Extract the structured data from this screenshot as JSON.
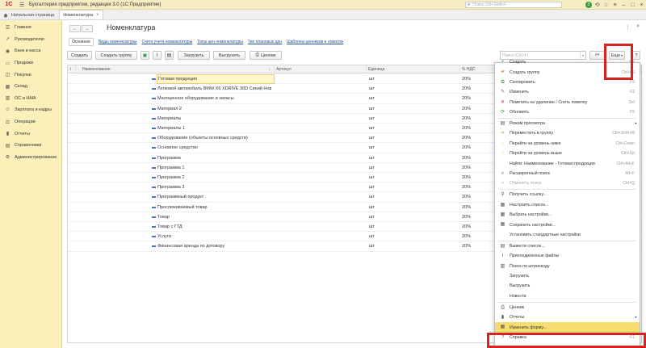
{
  "app": {
    "logo": "1С",
    "title": "Бухгалтерия предприятия, редакция 3.0  (1С:Предприятие)",
    "search_placeholder": "Поиск Ctrl+Shift+F",
    "bell_count": "3"
  },
  "tabs": {
    "home": "Начальная страница",
    "active": "Номенклатура"
  },
  "sidebar": {
    "items": [
      {
        "label": "Главное",
        "icon": "menu-icon"
      },
      {
        "label": "Руководителю",
        "icon": "chart-line-icon"
      },
      {
        "label": "Банк и касса",
        "icon": "bank-icon"
      },
      {
        "label": "Продажи",
        "icon": "cart-icon"
      },
      {
        "label": "Покупки",
        "icon": "basket-icon"
      },
      {
        "label": "Склад",
        "icon": "warehouse-icon"
      },
      {
        "label": "ОС и НМА",
        "icon": "assets-icon"
      },
      {
        "label": "Зарплата и кадры",
        "icon": "people-icon"
      },
      {
        "label": "Операции",
        "icon": "operations-icon"
      },
      {
        "label": "Отчеты",
        "icon": "report-icon"
      },
      {
        "label": "Справочники",
        "icon": "book-icon"
      },
      {
        "label": "Администрирование",
        "icon": "gear-icon"
      }
    ]
  },
  "page": {
    "title": "Номенклатура",
    "more_glyph": "⋮",
    "close_glyph": "×",
    "back_glyph": "←",
    "forward_glyph": "→"
  },
  "links": [
    {
      "label": "Основное",
      "active": true
    },
    {
      "label": "Виды номенклатуры"
    },
    {
      "label": "Счета учета номенклатуры"
    },
    {
      "label": "Типы цен номенклатуры"
    },
    {
      "label": "Тип плановых цен"
    },
    {
      "label": "Шаблоны ценников и этикеток"
    }
  ],
  "toolbar": {
    "create": "Создать",
    "create_group": "Создать группу",
    "load": "Загрузить",
    "unload": "Выгрузить",
    "price_tags": "Ценник",
    "search_placeholder": "Поиск (Ctrl+F)",
    "more": "Еще",
    "help": "?"
  },
  "table": {
    "columns": [
      "Наименование",
      "Артикул",
      "Единица",
      "% НДС"
    ],
    "rows": [
      {
        "name": "Готовая продукция",
        "unit": "шт",
        "vat": "20%"
      },
      {
        "name": "Легковой автомобиль  BMW X6  XDRIVE 30D Синий Нов",
        "unit": "шт",
        "vat": "20%"
      },
      {
        "name": "Малоценное оборудование и запасы",
        "unit": "шт",
        "vat": "20%"
      },
      {
        "name": "Материал 2",
        "unit": "шт",
        "vat": "20%"
      },
      {
        "name": "Материалы",
        "unit": "шт",
        "vat": "20%"
      },
      {
        "name": "Материалы 1",
        "unit": "шт",
        "vat": "20%"
      },
      {
        "name": "Оборудование (объекты основных средств)",
        "unit": "шт",
        "vat": "20%"
      },
      {
        "name": "Основное средство",
        "unit": "шт",
        "vat": "20%"
      },
      {
        "name": "Программа",
        "unit": "шт",
        "vat": "20%"
      },
      {
        "name": "Программа 1",
        "unit": "шт",
        "vat": "20%"
      },
      {
        "name": "Программа 2",
        "unit": "шт",
        "vat": "20%"
      },
      {
        "name": "Программа 3",
        "unit": "шт",
        "vat": "20%"
      },
      {
        "name": "Программный продукт",
        "unit": "шт",
        "vat": "20%"
      },
      {
        "name": "Прослеживаемый товар",
        "unit": "шт",
        "vat": "20%"
      },
      {
        "name": "Товар",
        "unit": "шт",
        "vat": "20%"
      },
      {
        "name": "Товар с ГТД",
        "unit": "шт",
        "vat": "20%"
      },
      {
        "name": "Услуги",
        "unit": "шт",
        "vat": "20%"
      },
      {
        "name": "Финансовая аренда по договору",
        "unit": "шт",
        "vat": "20%"
      }
    ]
  },
  "menu": {
    "items": [
      {
        "label": "Создать",
        "key": "Ins",
        "icon": "create-icon",
        "color": "#3a9b3e"
      },
      {
        "label": "Создать группу",
        "key": "Ctrl+F9",
        "icon": "folder-add-icon",
        "color": "#d6a53a"
      },
      {
        "label": "Скопировать",
        "key": "F9",
        "icon": "copy-icon",
        "color": "#3a9b3e"
      },
      {
        "label": "Изменить",
        "key": "F2",
        "icon": "edit-icon",
        "color": "#3a9b3e"
      },
      {
        "label": "Пометить на удаление / Снять пометку",
        "key": "Del",
        "icon": "delete-mark-icon",
        "color": "#d62222"
      },
      {
        "label": "Обновить",
        "key": "F5",
        "icon": "refresh-icon",
        "color": "#3a9b3e"
      },
      {
        "label": "Режим просмотра",
        "icon": "view-mode-icon",
        "submenu": true,
        "color": "#555"
      },
      {
        "label": "Переместить в группу",
        "key": "Ctrl+Shift+M",
        "icon": "move-group-icon",
        "color": "#d6a53a"
      },
      {
        "label": "Перейти на уровень ниже",
        "key": "Ctrl+Down",
        "icon": "level-down-icon",
        "color": "#d6a53a"
      },
      {
        "label": "Перейти на уровень выше",
        "key": "Ctrl+Up",
        "icon": "level-up-icon",
        "color": "#d6a53a"
      },
      {
        "label": "Найти: Наименование - Готовая продукция",
        "key": "Ctrl+Alt+F",
        "icon": "none",
        "color": "#555"
      },
      {
        "label": "Расширенный поиск",
        "key": "Alt+F",
        "icon": "advanced-search-icon",
        "color": "#555"
      },
      {
        "label": "Отменить поиск",
        "key": "Ctrl+Q",
        "icon": "cancel-search-icon",
        "disabled": true,
        "color": "#aaa"
      },
      {
        "label": "Получить ссылку...",
        "icon": "link-icon",
        "color": "#555"
      },
      {
        "label": "Настроить список...",
        "icon": "settings-list-icon",
        "color": "#555"
      },
      {
        "label": "Выбрать настройки...",
        "icon": "choose-settings-icon",
        "color": "#555"
      },
      {
        "label": "Сохранить настройки...",
        "icon": "save-settings-icon",
        "color": "#555"
      },
      {
        "label": "Установить стандартные настройки",
        "icon": "none",
        "color": "#555"
      },
      {
        "label": "Вывести список...",
        "icon": "output-list-icon",
        "color": "#555"
      },
      {
        "label": "Присоединенные файлы",
        "icon": "attach-icon",
        "color": "#555"
      },
      {
        "label": "Поиск по штрихкоду",
        "icon": "barcode-icon",
        "color": "#555"
      },
      {
        "label": "Загрузить",
        "icon": "none",
        "color": "#555"
      },
      {
        "label": "Выгрузить",
        "icon": "none",
        "color": "#555"
      },
      {
        "label": "Новости",
        "icon": "none",
        "color": "#555"
      },
      {
        "label": "Ценник",
        "icon": "print-icon",
        "color": "#555"
      },
      {
        "label": "Отчеты",
        "icon": "reports-icon",
        "submenu": true,
        "color": "#555"
      },
      {
        "label": "Изменить форму...",
        "icon": "change-form-icon",
        "color": "#555"
      },
      {
        "label": "Справка",
        "key": "F1",
        "icon": "help-icon",
        "color": "#555"
      }
    ]
  },
  "colors": {
    "sidebar_bg": "#fbf0b9",
    "highlight_red": "#d62222",
    "link_blue": "#1a4f9c"
  }
}
